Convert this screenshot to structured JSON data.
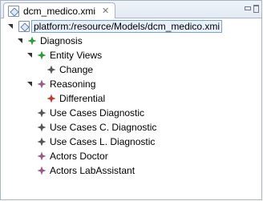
{
  "editor": {
    "tab_title": "dcm_medico.xmi",
    "tab_close": "✕"
  },
  "tree": {
    "root": "platform:/resource/Models/dcm_medico.xmi",
    "items": [
      {
        "label": "Diagnosis",
        "color": "#2e9b38"
      },
      {
        "label": "Entity Views",
        "color": "#2e9b38"
      },
      {
        "label": "Change",
        "color": "#555555"
      },
      {
        "label": "Reasoning",
        "color": "#9a5a88"
      },
      {
        "label": "Differential",
        "color": "#c43a2c"
      },
      {
        "label": "Use Cases Diagnostic",
        "color": "#555555"
      },
      {
        "label": "Use Cases C. Diagnostic",
        "color": "#555555"
      },
      {
        "label": "Use Cases L. Diagnostic",
        "color": "#555555"
      },
      {
        "label": "Actors Doctor",
        "color": "#9a5a88"
      },
      {
        "label": "Actors LabAssistant",
        "color": "#9a5a88"
      }
    ]
  }
}
